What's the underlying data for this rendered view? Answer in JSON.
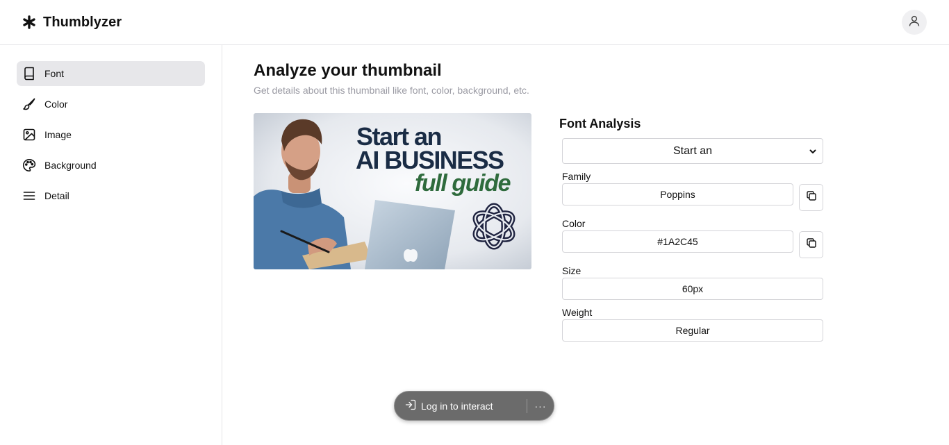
{
  "app": {
    "name": "Thumblyzer",
    "logo_icon": "asterisk-icon"
  },
  "header": {
    "profile_icon": "user-icon"
  },
  "sidebar": {
    "items": [
      {
        "label": "Font",
        "icon": "book-icon",
        "active": true
      },
      {
        "label": "Color",
        "icon": "brush-icon",
        "active": false
      },
      {
        "label": "Image",
        "icon": "image-icon",
        "active": false
      },
      {
        "label": "Background",
        "icon": "palette-icon",
        "active": false
      },
      {
        "label": "Detail",
        "icon": "menu-icon",
        "active": false
      }
    ]
  },
  "main": {
    "title": "Analyze your thumbnail",
    "subtitle": "Get details about this thumbnail like font, color, background, etc.",
    "thumbnail": {
      "line1": "Start an",
      "line2": "AI BUSINESS",
      "line3": "full guide"
    }
  },
  "font_analysis": {
    "title": "Font Analysis",
    "selected_text": "Start an",
    "family_label": "Family",
    "family_value": "Poppins",
    "color_label": "Color",
    "color_value": "#1A2C45",
    "size_label": "Size",
    "size_value": "60px",
    "weight_label": "Weight",
    "weight_value": "Regular"
  },
  "toast": {
    "label": "Log in to interact",
    "more": "···"
  },
  "colors": {
    "active_nav": "#e7e7ea",
    "subtitle": "#9a9aa3",
    "thumb_navy": "#1A2C45",
    "thumb_green": "#2f6b3d"
  }
}
